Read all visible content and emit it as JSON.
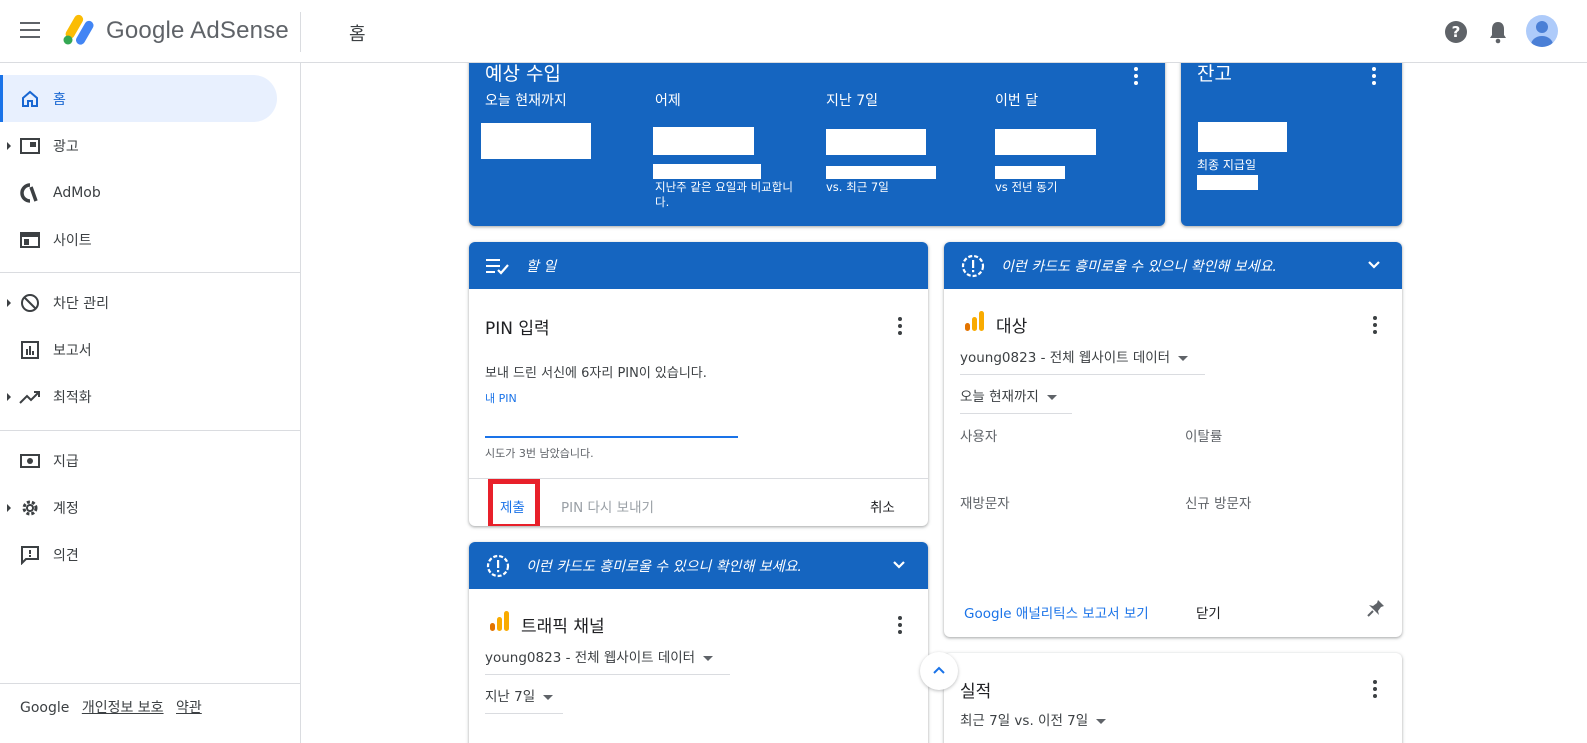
{
  "app": {
    "brand": "Google AdSense",
    "page_title": "홈"
  },
  "sidebar": {
    "items": [
      {
        "label": "홈",
        "icon": "home-icon"
      },
      {
        "label": "광고",
        "icon": "ads-icon"
      },
      {
        "label": "AdMob",
        "icon": "admob-icon"
      },
      {
        "label": "사이트",
        "icon": "sites-icon"
      },
      {
        "label": "차단 관리",
        "icon": "block-icon"
      },
      {
        "label": "보고서",
        "icon": "reports-icon"
      },
      {
        "label": "최적화",
        "icon": "optimize-icon"
      },
      {
        "label": "지급",
        "icon": "payments-icon"
      },
      {
        "label": "계정",
        "icon": "settings-icon"
      },
      {
        "label": "의견",
        "icon": "feedback-icon"
      }
    ],
    "footer": {
      "google": "Google",
      "privacy": "개인정보 보호",
      "terms": "약관"
    }
  },
  "estimated_earnings": {
    "title": "예상 수입",
    "columns": [
      {
        "label": "오늘 현재까지",
        "sub": ""
      },
      {
        "label": "어제",
        "sub": "지난주 같은 요일과 비교합니다."
      },
      {
        "label": "지난 7일",
        "sub": "vs. 최근 7일"
      },
      {
        "label": "이번 달",
        "sub": "vs 전년 동기"
      }
    ]
  },
  "balance": {
    "title": "잔고",
    "last_payment_label": "최종 지급일"
  },
  "todo": {
    "header": "할 일",
    "title": "PIN 입력",
    "description": "보내 드린 서신에 6자리 PIN이 있습니다.",
    "pin_label": "내 PIN",
    "pin_value": "",
    "attempts": "시도가 3번 남았습니다.",
    "submit": "제출",
    "resend": "PIN 다시 보내기",
    "cancel": "취소"
  },
  "suggestion_left": {
    "header": "이런 카드도 흥미로울 수 있으니 확인해 보세요.",
    "title": "트래픽 채널",
    "property": "young0823 - 전체 웹사이트 데이터",
    "range": "지난 7일"
  },
  "suggestion_right": {
    "header": "이런 카드도 흥미로울 수 있으니 확인해 보세요.",
    "title": "대상",
    "property": "young0823 - 전체 웹사이트 데이터",
    "range": "오늘 현재까지",
    "metrics": [
      "사용자",
      "이탈률",
      "재방문자",
      "신규 방문자"
    ],
    "analytics_link": "Google 애널리틱스 보고서 보기",
    "close": "닫기"
  },
  "performance": {
    "title": "실적",
    "range": "최근 7일 vs. 이전 7일"
  },
  "colors": {
    "primary": "#1565c0",
    "accent": "#1a73e8",
    "highlight": "#e8202a"
  }
}
